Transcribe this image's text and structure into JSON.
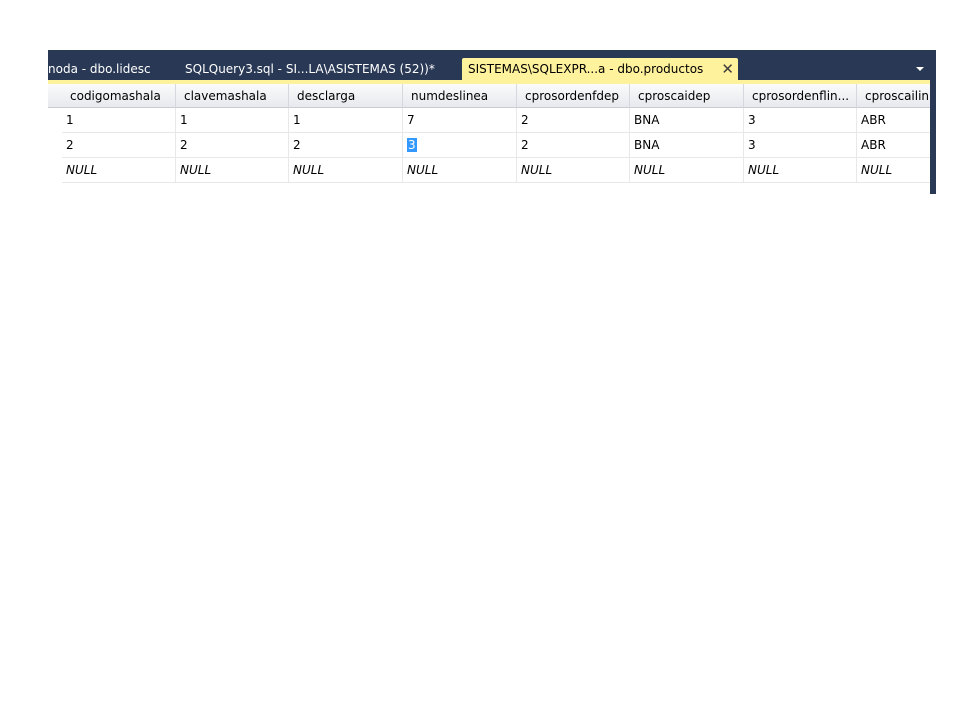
{
  "tabs": [
    {
      "label": "noda - dbo.lidesc",
      "active": false
    },
    {
      "label": "SQLQuery3.sql - SI...LA\\ASISTEMAS (52))*",
      "active": false
    },
    {
      "label": "SISTEMAS\\SQLEXPR...a - dbo.productos",
      "active": true
    }
  ],
  "close_glyph": "✕",
  "grid": {
    "columns": [
      "codigomashala",
      "clavemashala",
      "desclarga",
      "numdeslinea",
      "cprosordenfdep",
      "cproscaidep",
      "cprosordenflin...",
      "cproscailin"
    ],
    "rows": [
      [
        "1",
        "1",
        "1",
        "7",
        "2",
        "BNA",
        "3",
        "ABR"
      ],
      [
        "2",
        "2",
        "2",
        "3",
        "2",
        "BNA",
        "3",
        "ABR"
      ],
      [
        "NULL",
        "NULL",
        "NULL",
        "NULL",
        "NULL",
        "NULL",
        "NULL",
        "NULL"
      ]
    ],
    "selected_cell_text": "3"
  },
  "colors": {
    "frame": "#293955",
    "active_tab": "#fff29d",
    "selection": "#3399ff"
  }
}
